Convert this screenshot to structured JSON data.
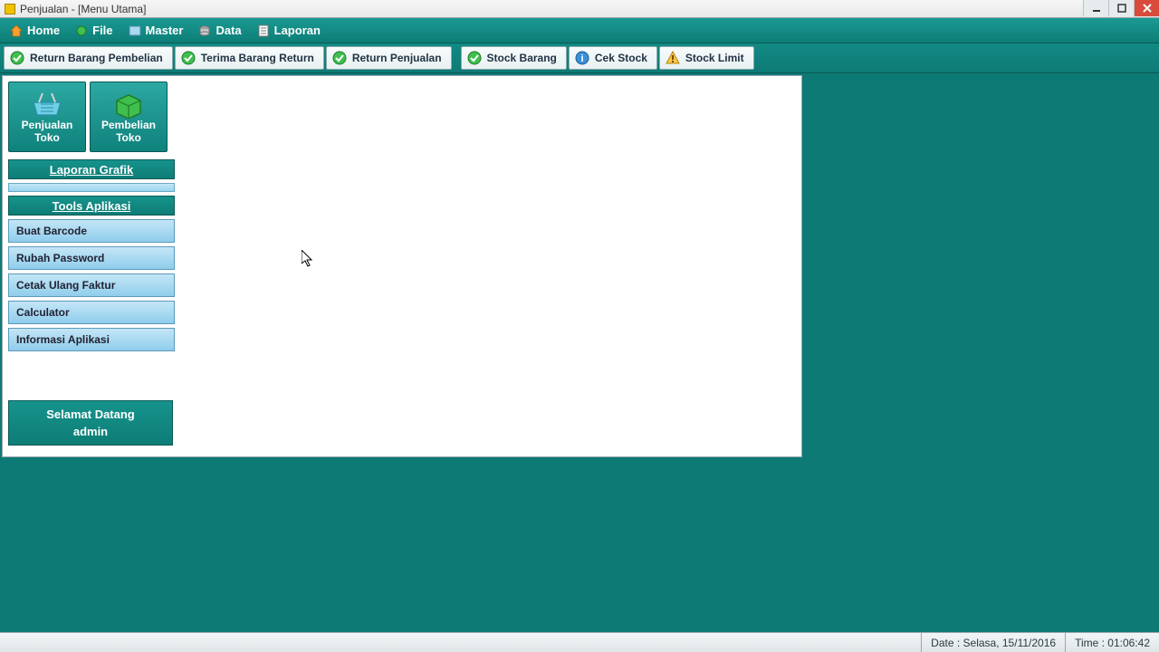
{
  "title": {
    "main": "Penjualan - [Menu Utama]",
    "faded": ""
  },
  "menubar": {
    "items": [
      {
        "label": "Home",
        "icon": "home-icon"
      },
      {
        "label": "File",
        "icon": "file-icon"
      },
      {
        "label": "Master",
        "icon": "master-icon"
      },
      {
        "label": "Data",
        "icon": "data-icon"
      },
      {
        "label": "Laporan",
        "icon": "report-icon"
      }
    ]
  },
  "toolbar": {
    "items": [
      {
        "label": "Return Barang Pembelian",
        "icon": "check-green-icon"
      },
      {
        "label": "Terima Barang Return",
        "icon": "check-green-icon"
      },
      {
        "label": "Return Penjualan",
        "icon": "check-green-icon"
      },
      {
        "label": "Stock Barang",
        "icon": "check-green-icon"
      },
      {
        "label": "Cek Stock",
        "icon": "info-icon"
      },
      {
        "label": "Stock Limit",
        "icon": "warning-icon"
      }
    ]
  },
  "sidebar": {
    "big_buttons": {
      "sale": {
        "line1": "Penjualan",
        "line2": "Toko"
      },
      "purchase": {
        "line1": "Pembelian",
        "line2": "Toko"
      }
    },
    "section_graph": "Laporan Grafik",
    "section_tools": "Tools Aplikasi",
    "tools": [
      {
        "label": "Buat Barcode"
      },
      {
        "label": "Rubah Password"
      },
      {
        "label": "Cetak Ulang Faktur"
      },
      {
        "label": "Calculator"
      },
      {
        "label": "Informasi Aplikasi"
      }
    ],
    "welcome": {
      "line1": "Selamat Datang",
      "line2": "admin"
    }
  },
  "statusbar": {
    "date": "Date : Selasa, 15/11/2016",
    "time": "Time : 01:06:42"
  }
}
